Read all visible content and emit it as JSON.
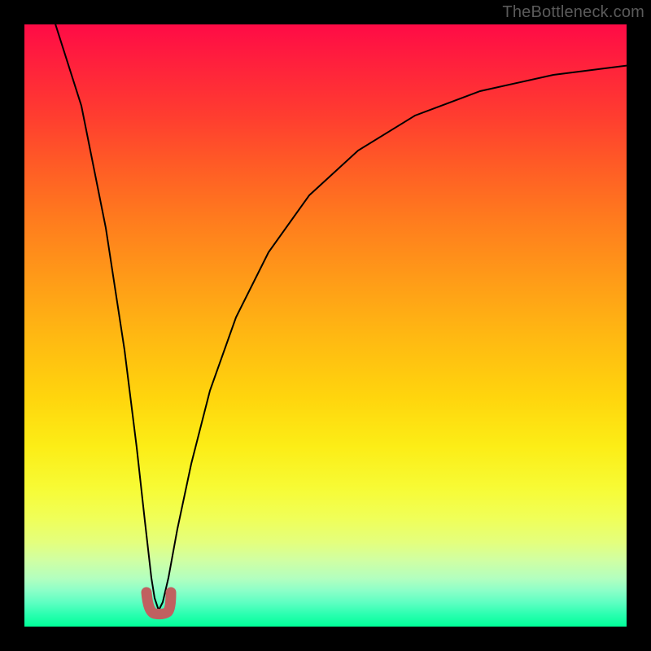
{
  "watermark": "TheBottleneck.com",
  "chart_data": {
    "type": "line",
    "title": "",
    "xlabel": "",
    "ylabel": "",
    "xlim": [
      0,
      100
    ],
    "ylim": [
      0,
      100
    ],
    "grid": false,
    "legend": false,
    "series": [
      {
        "name": "bottleneck-curve",
        "x": [
          0,
          3,
          6,
          9,
          12,
          15,
          17,
          18,
          19,
          20,
          21,
          22,
          23,
          25,
          28,
          32,
          37,
          43,
          50,
          58,
          67,
          77,
          88,
          100
        ],
        "y": [
          100,
          85,
          70,
          55,
          41,
          27,
          16,
          10,
          5,
          2,
          1,
          2,
          5,
          11,
          20,
          30,
          41,
          51,
          60,
          68,
          75,
          81,
          86,
          90
        ]
      }
    ],
    "marker": {
      "name": "optimal-range",
      "x": [
        18.5,
        19,
        20,
        21,
        21.5
      ],
      "y": [
        6,
        2.5,
        1.5,
        2.5,
        6
      ]
    },
    "background_gradient": {
      "top_color": "#ff0b46",
      "bottom_color": "#00ff99"
    }
  }
}
